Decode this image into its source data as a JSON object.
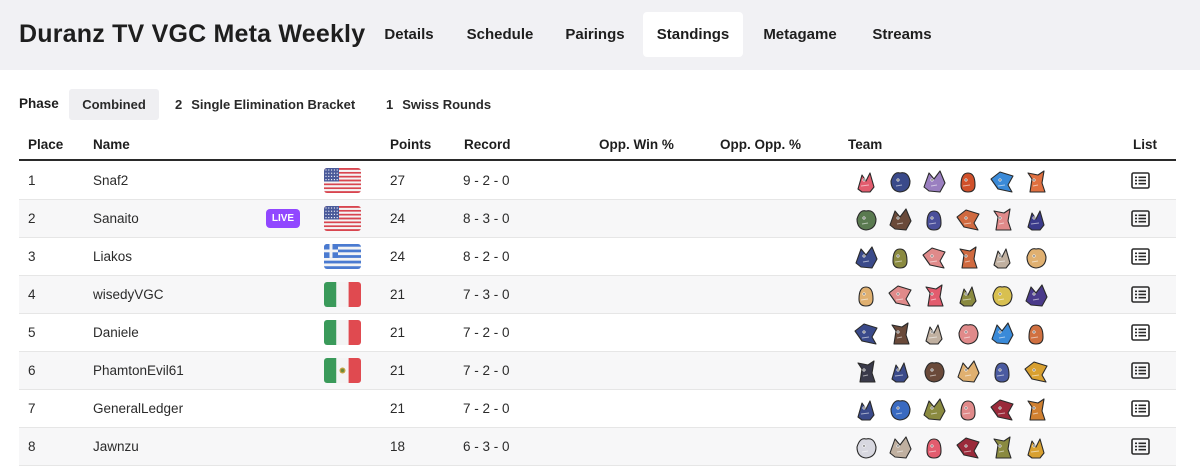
{
  "header": {
    "title": "Duranz TV VGC Meta Weekly",
    "tabs": [
      {
        "label": "Details",
        "active": false
      },
      {
        "label": "Schedule",
        "active": false
      },
      {
        "label": "Pairings",
        "active": false
      },
      {
        "label": "Standings",
        "active": true
      },
      {
        "label": "Metagame",
        "active": false
      },
      {
        "label": "Streams",
        "active": false
      }
    ]
  },
  "phase": {
    "label": "Phase",
    "options": [
      {
        "num": "",
        "label": "Combined",
        "active": true
      },
      {
        "num": "2",
        "label": "Single Elimination Bracket",
        "active": false
      },
      {
        "num": "1",
        "label": "Swiss Rounds",
        "active": false
      }
    ]
  },
  "table": {
    "columns": {
      "place": "Place",
      "name": "Name",
      "points": "Points",
      "record": "Record",
      "opp_win": "Opp. Win %",
      "opp_opp": "Opp. Opp. %",
      "team": "Team",
      "list": "List"
    },
    "live_label": "LIVE",
    "rows": [
      {
        "place": "1",
        "name": "Snaf2",
        "flag": "us",
        "live": false,
        "points": "27",
        "record": "9 - 2 - 0",
        "opp_win": "",
        "opp_opp": "",
        "team": [
          "#e25c6e",
          "#3a4a8a",
          "#9a7fc0",
          "#d0502a",
          "#3a8ad8",
          "#e07040"
        ]
      },
      {
        "place": "2",
        "name": "Sanaito",
        "flag": "us",
        "live": true,
        "points": "24",
        "record": "8 - 3 - 0",
        "opp_win": "",
        "opp_opp": "",
        "team": [
          "#5a7a50",
          "#6a4a3a",
          "#4a4f9a",
          "#d06a40",
          "#e08a8a",
          "#3a3a8a"
        ]
      },
      {
        "place": "3",
        "name": "Liakos",
        "flag": "gr",
        "live": false,
        "points": "24",
        "record": "8 - 2 - 0",
        "opp_win": "",
        "opp_opp": "",
        "team": [
          "#3a4a8a",
          "#8a8a40",
          "#e08a8a",
          "#d06a40",
          "#c0b0a0",
          "#e0b070"
        ]
      },
      {
        "place": "4",
        "name": "wisedyVGC",
        "flag": "it",
        "live": false,
        "points": "21",
        "record": "7 - 3 - 0",
        "opp_win": "",
        "opp_opp": "",
        "team": [
          "#e0b070",
          "#e08a8a",
          "#e25c6e",
          "#8a8a40",
          "#d8c050",
          "#4a3a8a"
        ]
      },
      {
        "place": "5",
        "name": "Daniele",
        "flag": "it",
        "live": false,
        "points": "21",
        "record": "7 - 2 - 0",
        "opp_win": "",
        "opp_opp": "",
        "team": [
          "#3a4a8a",
          "#6a4a3a",
          "#c0b0a0",
          "#e08a8a",
          "#3a8ad8",
          "#d07040"
        ]
      },
      {
        "place": "6",
        "name": "PhamtonEvil61",
        "flag": "mx",
        "live": false,
        "points": "21",
        "record": "7 - 2 - 0",
        "opp_win": "",
        "opp_opp": "",
        "team": [
          "#3a3a4a",
          "#3a4a8a",
          "#6a4a3a",
          "#e0b070",
          "#4a5aa0",
          "#d8a030"
        ]
      },
      {
        "place": "7",
        "name": "GeneralLedger",
        "flag": "",
        "live": false,
        "points": "21",
        "record": "7 - 2 - 0",
        "opp_win": "",
        "opp_opp": "",
        "team": [
          "#3a4a8a",
          "#3a6ac0",
          "#8a8a40",
          "#e08a8a",
          "#9a2a3a",
          "#d08030"
        ]
      },
      {
        "place": "8",
        "name": "Jawnzu",
        "flag": "",
        "live": false,
        "points": "18",
        "record": "6 - 3 - 0",
        "opp_win": "",
        "opp_opp": "",
        "team": [
          "#d8d8e0",
          "#c0b0a0",
          "#e25c6e",
          "#9a2a3a",
          "#8a8a40",
          "#d8a030"
        ]
      }
    ]
  }
}
